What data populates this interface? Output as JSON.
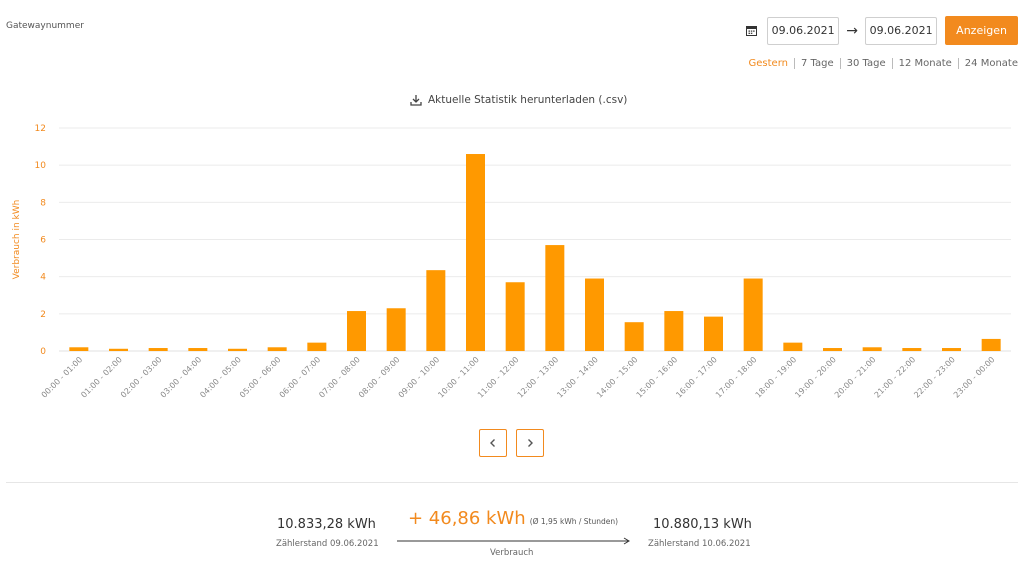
{
  "header": {
    "gateway_label": "Gatewaynummer",
    "date_from": "09.06.2021",
    "date_to": "09.06.2021",
    "show_label": "Anzeigen",
    "arrow": "→",
    "calendar_icon": "calendar-icon"
  },
  "ranges": [
    {
      "label": "Gestern",
      "active": true
    },
    {
      "label": "7 Tage",
      "active": false
    },
    {
      "label": "30 Tage",
      "active": false
    },
    {
      "label": "12 Monate",
      "active": false
    },
    {
      "label": "24 Monate",
      "active": false
    }
  ],
  "download_label": "Aktuelle Statistik herunterladen (.csv)",
  "colors": {
    "accent": "#f28a1e",
    "bar": "#ff9900",
    "grid": "#ebebeb",
    "axis": "#e0e0e0"
  },
  "chart_data": {
    "type": "bar",
    "title": "",
    "xlabel": "",
    "ylabel": "Verbrauch in kWh",
    "ylim": [
      0,
      12
    ],
    "yticks": [
      0,
      2,
      4,
      6,
      8,
      10,
      12
    ],
    "grid": true,
    "categories": [
      "00:00 - 01:00",
      "01:00 - 02:00",
      "02:00 - 03:00",
      "03:00 - 04:00",
      "04:00 - 05:00",
      "05:00 - 06:00",
      "06:00 - 07:00",
      "07:00 - 08:00",
      "08:00 - 09:00",
      "09:00 - 10:00",
      "10:00 - 11:00",
      "11:00 - 12:00",
      "12:00 - 13:00",
      "13:00 - 14:00",
      "14:00 - 15:00",
      "15:00 - 16:00",
      "16:00 - 17:00",
      "17:00 - 18:00",
      "18:00 - 19:00",
      "19:00 - 20:00",
      "20:00 - 21:00",
      "21:00 - 22:00",
      "22:00 - 23:00",
      "23:00 - 00:00"
    ],
    "values": [
      0.2,
      0.12,
      0.16,
      0.16,
      0.12,
      0.2,
      0.45,
      2.15,
      2.3,
      4.35,
      10.6,
      3.7,
      5.7,
      3.9,
      1.55,
      2.15,
      1.85,
      3.9,
      0.45,
      0.16,
      0.2,
      0.16,
      0.16,
      0.65
    ]
  },
  "navigation": {
    "prev_icon": "chevron-left-icon",
    "next_icon": "chevron-right-icon"
  },
  "summary": {
    "start_value": "10.833,28 kWh",
    "start_label": "Zählerstand 09.06.2021",
    "consumption": "+ 46,86 kWh",
    "average": "(Ø 1,95 kWh / Stunden)",
    "consumption_label": "Verbrauch",
    "end_value": "10.880,13 kWh",
    "end_label": "Zählerstand 10.06.2021"
  }
}
